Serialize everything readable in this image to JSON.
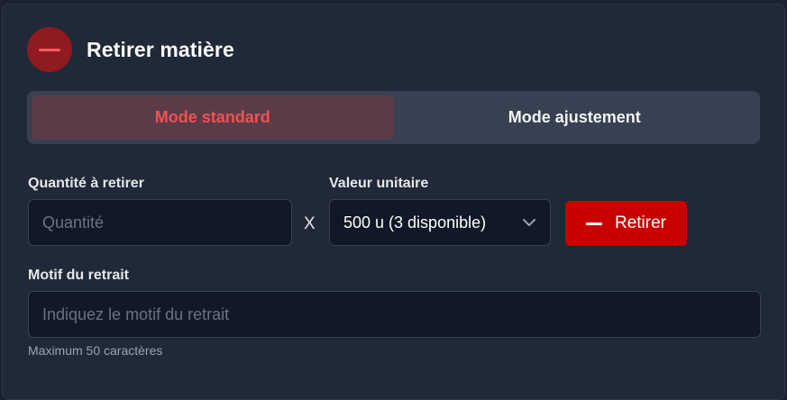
{
  "header": {
    "title": "Retirer matière",
    "icon": "minus-circle-icon"
  },
  "modes": {
    "standard_label": "Mode standard",
    "adjust_label": "Mode ajustement",
    "active": "standard"
  },
  "quantity": {
    "label": "Quantité à retirer",
    "placeholder": "Quantité",
    "value": ""
  },
  "multiplier": "X",
  "unit_value": {
    "label": "Valeur unitaire",
    "selected": "500 u (3 disponible)"
  },
  "withdraw_button": {
    "label": "Retirer",
    "icon": "minus-icon"
  },
  "reason": {
    "label": "Motif du retrait",
    "placeholder": "Indiquez le motif du retrait",
    "value": "",
    "hint": "Maximum 50 caractères"
  },
  "colors": {
    "accent_red": "#c80000",
    "active_mode_text": "#f05252",
    "panel_bg": "#1f2937",
    "input_bg": "#111827"
  }
}
